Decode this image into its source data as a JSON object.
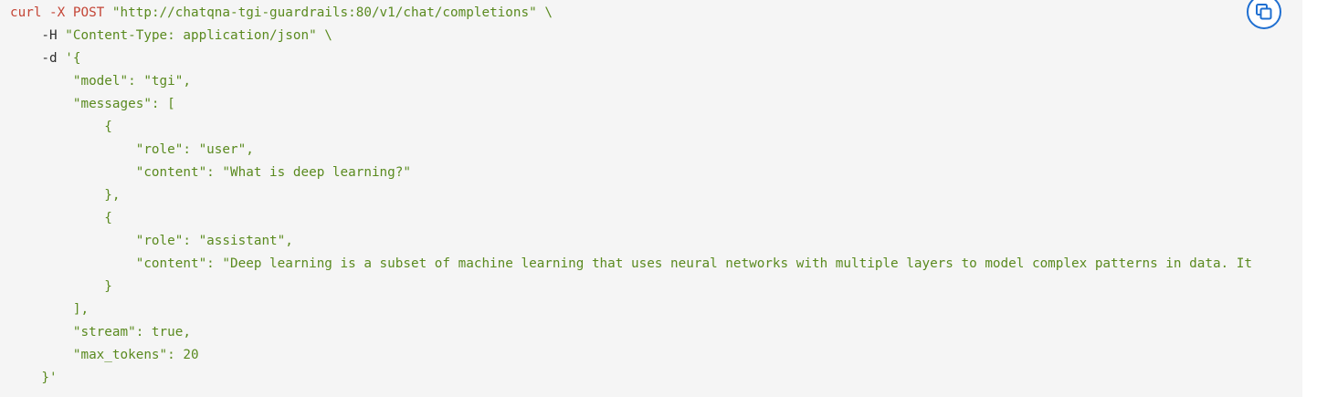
{
  "code": {
    "lines": [
      [
        {
          "t": "curl -X POST ",
          "c": "cmd"
        },
        {
          "t": "\"http://chatqna-tgi-guardrails:80/v1/chat/completions\" \\",
          "c": "str"
        }
      ],
      [
        {
          "t": "    -H ",
          "c": "pln"
        },
        {
          "t": "\"Content-Type: application/json\" \\",
          "c": "str"
        }
      ],
      [
        {
          "t": "    -d ",
          "c": "pln"
        },
        {
          "t": "'{",
          "c": "str"
        }
      ],
      [
        {
          "t": "        \"model\": \"tgi\",",
          "c": "str"
        }
      ],
      [
        {
          "t": "        \"messages\": [",
          "c": "str"
        }
      ],
      [
        {
          "t": "            {",
          "c": "str"
        }
      ],
      [
        {
          "t": "                \"role\": \"user\",",
          "c": "str"
        }
      ],
      [
        {
          "t": "                \"content\": \"What is deep learning?\"",
          "c": "str"
        }
      ],
      [
        {
          "t": "            },",
          "c": "str"
        }
      ],
      [
        {
          "t": "            {",
          "c": "str"
        }
      ],
      [
        {
          "t": "                \"role\": \"assistant\",",
          "c": "str"
        }
      ],
      [
        {
          "t": "                \"content\": \"Deep learning is a subset of machine learning that uses neural networks with multiple layers to model complex patterns in data. It",
          "c": "str"
        }
      ],
      [
        {
          "t": "            }",
          "c": "str"
        }
      ],
      [
        {
          "t": "        ],",
          "c": "str"
        }
      ],
      [
        {
          "t": "        \"stream\": true,",
          "c": "str"
        }
      ],
      [
        {
          "t": "        \"max_tokens\": 20",
          "c": "str"
        }
      ],
      [
        {
          "t": "    }'",
          "c": "str"
        }
      ]
    ]
  },
  "copy_button": {
    "icon": "copy-icon",
    "accent_color": "#1f6fd1"
  }
}
